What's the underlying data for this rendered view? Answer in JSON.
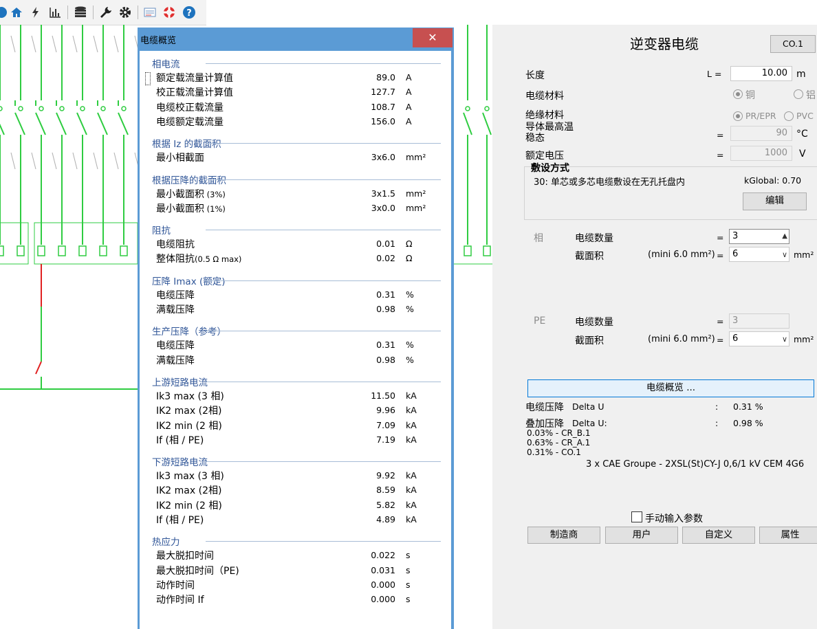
{
  "toolbar": {
    "icons": [
      "globe-icon",
      "home-icon",
      "lightning-icon",
      "bar-chart-icon",
      "database-icon",
      "wrench-icon",
      "gear-icon",
      "report-icon",
      "lifebuoy-icon",
      "help-icon"
    ]
  },
  "dialog": {
    "title": "电缆概览",
    "close_glyph": "✕",
    "sections": [
      {
        "title": "相电流",
        "rows": [
          {
            "label": "额定载流量计算值",
            "suffix": "",
            "value": "89.0",
            "unit": "A"
          },
          {
            "label": "校正载流量计算值",
            "suffix": "",
            "value": "127.7",
            "unit": "A"
          },
          {
            "label": "电缆校正载流量",
            "suffix": "",
            "value": "108.7",
            "unit": "A"
          },
          {
            "label": "电缆额定载流量",
            "suffix": "",
            "value": "156.0",
            "unit": "A"
          }
        ]
      },
      {
        "title": "根据 Iz 的截面积",
        "rows": [
          {
            "label": "最小相截面",
            "suffix": "",
            "value": "3x6.0",
            "unit": "mm²"
          }
        ]
      },
      {
        "title": "根据压降的截面积",
        "rows": [
          {
            "label": "最小截面积",
            "suffix": " (3%)",
            "value": "3x1.5",
            "unit": "mm²"
          },
          {
            "label": "最小截面积",
            "suffix": " (1%)",
            "value": "3x0.0",
            "unit": "mm²"
          }
        ]
      },
      {
        "title": "阻抗",
        "rows": [
          {
            "label": "电缆阻抗",
            "suffix": "",
            "value": "0.01",
            "unit": "Ω"
          },
          {
            "label": "整体阻抗",
            "suffix": "(0.5 Ω max)",
            "value": "0.02",
            "unit": "Ω"
          }
        ]
      },
      {
        "title": "压降 Imax (额定)",
        "rows": [
          {
            "label": "电缆压降",
            "suffix": "",
            "value": "0.31",
            "unit": "%"
          },
          {
            "label": "满载压降",
            "suffix": "",
            "value": "0.98",
            "unit": "%"
          }
        ]
      },
      {
        "title": "生产压降（参考）",
        "rows": [
          {
            "label": "电缆压降",
            "suffix": "",
            "value": "0.31",
            "unit": "%"
          },
          {
            "label": "满载压降",
            "suffix": "",
            "value": "0.98",
            "unit": "%"
          }
        ]
      },
      {
        "title": "上游短路电流",
        "rows": [
          {
            "label": "Ik3 max (3 相)",
            "suffix": "",
            "value": "11.50",
            "unit": "kA"
          },
          {
            "label": "IK2 max (2相)",
            "suffix": "",
            "value": "9.96",
            "unit": "kA"
          },
          {
            "label": "IK2 min (2 相)",
            "suffix": "",
            "value": "7.09",
            "unit": "kA"
          },
          {
            "label": "If (相 / PE)",
            "suffix": "",
            "value": "7.19",
            "unit": "kA"
          }
        ]
      },
      {
        "title": "下游短路电流",
        "rows": [
          {
            "label": "Ik3 max (3 相)",
            "suffix": "",
            "value": "9.92",
            "unit": "kA"
          },
          {
            "label": "IK2 max (2相)",
            "suffix": "",
            "value": "8.59",
            "unit": "kA"
          },
          {
            "label": "IK2 min (2 相)",
            "suffix": "",
            "value": "5.82",
            "unit": "kA"
          },
          {
            "label": "If (相 / PE)",
            "suffix": "",
            "value": "4.89",
            "unit": "kA"
          }
        ]
      },
      {
        "title": "热应力",
        "rows": [
          {
            "label": "最大脱扣时间",
            "suffix": "",
            "value": "0.022",
            "unit": "s"
          },
          {
            "label": "最大脱扣时间（PE)",
            "suffix": "",
            "value": "0.031",
            "unit": "s"
          },
          {
            "label": "动作时间",
            "suffix": "",
            "value": "0.000",
            "unit": "s"
          },
          {
            "label": "动作时间 If",
            "suffix": "",
            "value": "0.000",
            "unit": "s"
          }
        ]
      }
    ]
  },
  "panel": {
    "title": "逆变器电缆",
    "code_button": "CO.1",
    "length": {
      "label": "长度",
      "symbol": "L =",
      "value": "10.00",
      "unit": "m"
    },
    "material": {
      "label": "电缆材料",
      "opt1": "铜",
      "opt2": "铝"
    },
    "insulation": {
      "label": "绝缘材料",
      "opt1": "PR/EPR",
      "opt2": "PVC"
    },
    "max_temp": {
      "label1": "导体最高温",
      "label2": "稳态",
      "eq": "=",
      "value": "90",
      "unit": "°C"
    },
    "voltage": {
      "label": "额定电压",
      "eq": "=",
      "value": "1000",
      "unit": "V"
    },
    "laying": {
      "title": "敷设方式",
      "desc": "30: 单芯或多芯电缆敷设在无孔托盘内",
      "kglobal": "kGlobal: 0.70",
      "edit_button": "编辑"
    },
    "phase": {
      "tag": "相",
      "count_label": "电缆数量",
      "eq": "=",
      "count_value": "3",
      "section_label": "截面积",
      "mini": "(mini 6.0 mm²)",
      "section_value": "6",
      "unit": "mm²"
    },
    "pe": {
      "tag": "PE",
      "count_label": "电缆数量",
      "eq": "=",
      "count_value": "3",
      "section_label": "截面积",
      "mini": "(mini 6.0 mm²)",
      "section_value": "6",
      "unit": "mm²"
    },
    "overview_button": "电缆概览 ...",
    "drop": {
      "label": "电缆压降",
      "sub": "Delta U",
      "colon": ":",
      "value": "0.31 %"
    },
    "cum_drop": {
      "label": "叠加压降",
      "sub": "Delta U:",
      "colon": ":",
      "value": "0.98 %"
    },
    "cum_list": [
      "0.03% - CR_B.1",
      "0.63% - CR_A.1",
      "0.31% - CO.1"
    ],
    "cable_desc": "3 x CAE Groupe - 2XSL(St)CY-J 0,6/1 kV CEM 4G6",
    "manual_label": "手动输入参数",
    "buttons": {
      "manufacturer": "制造商",
      "user": "用户",
      "custom": "自定义",
      "properties": "属性"
    }
  }
}
